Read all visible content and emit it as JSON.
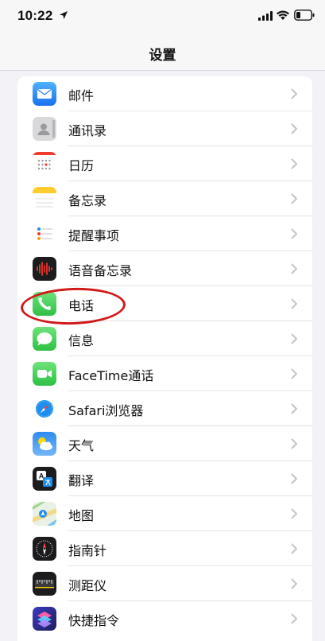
{
  "status_bar": {
    "time": "10:22"
  },
  "nav": {
    "title": "设置"
  },
  "items": [
    {
      "label": "邮件",
      "icon": "mail-icon"
    },
    {
      "label": "通讯录",
      "icon": "contacts-icon"
    },
    {
      "label": "日历",
      "icon": "calendar-icon"
    },
    {
      "label": "备忘录",
      "icon": "notes-icon"
    },
    {
      "label": "提醒事项",
      "icon": "reminders-icon"
    },
    {
      "label": "语音备忘录",
      "icon": "voice-memos-icon"
    },
    {
      "label": "电话",
      "icon": "phone-icon"
    },
    {
      "label": "信息",
      "icon": "messages-icon"
    },
    {
      "label": "FaceTime通话",
      "icon": "facetime-icon"
    },
    {
      "label": "Safari浏览器",
      "icon": "safari-icon"
    },
    {
      "label": "天气",
      "icon": "weather-icon"
    },
    {
      "label": "翻译",
      "icon": "translate-icon"
    },
    {
      "label": "地图",
      "icon": "maps-icon"
    },
    {
      "label": "指南针",
      "icon": "compass-icon"
    },
    {
      "label": "测距仪",
      "icon": "measure-icon"
    },
    {
      "label": "快捷指令",
      "icon": "shortcuts-icon"
    }
  ],
  "highlight_color": "#d11a1a"
}
